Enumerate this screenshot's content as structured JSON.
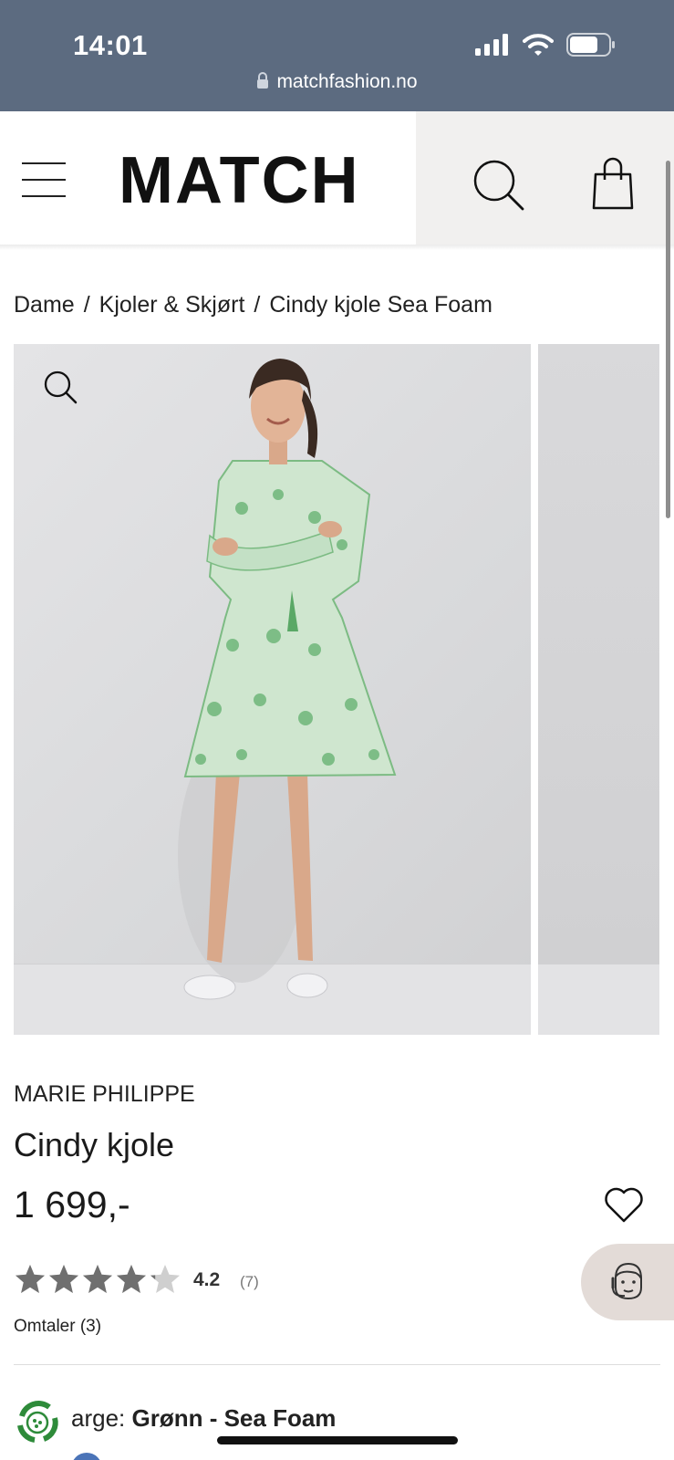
{
  "status_bar": {
    "time": "14:01",
    "url": "matchfashion.no",
    "icons": [
      "signal-icon",
      "wifi-icon",
      "battery-icon"
    ]
  },
  "header": {
    "logo": "MATCH",
    "icons": [
      "menu-icon",
      "search-icon",
      "shopping-bag-icon"
    ]
  },
  "breadcrumb": {
    "items": [
      "Dame",
      "Kjoler & Skjørt",
      "Cindy kjole Sea Foam"
    ],
    "separator": "/"
  },
  "gallery": {
    "icons": [
      "zoom-icon"
    ]
  },
  "product": {
    "brand": "MARIE PHILIPPE",
    "name": "Cindy kjole",
    "price": "1 699,-",
    "rating": "4.2",
    "rating_value": 4.2,
    "rating_max": 5,
    "rating_count": "(7)",
    "reviews_label": "Omtaler (3)",
    "color_label_visible": "arge:",
    "color_value": "Grønn - Sea Foam"
  },
  "colors": {
    "header_bar": "#5c6b80",
    "star": "#6f6f6f",
    "chat_bubble": "#e3dbd7",
    "eco_green": "#2e8b3a",
    "swatch": "#4b74b8"
  }
}
